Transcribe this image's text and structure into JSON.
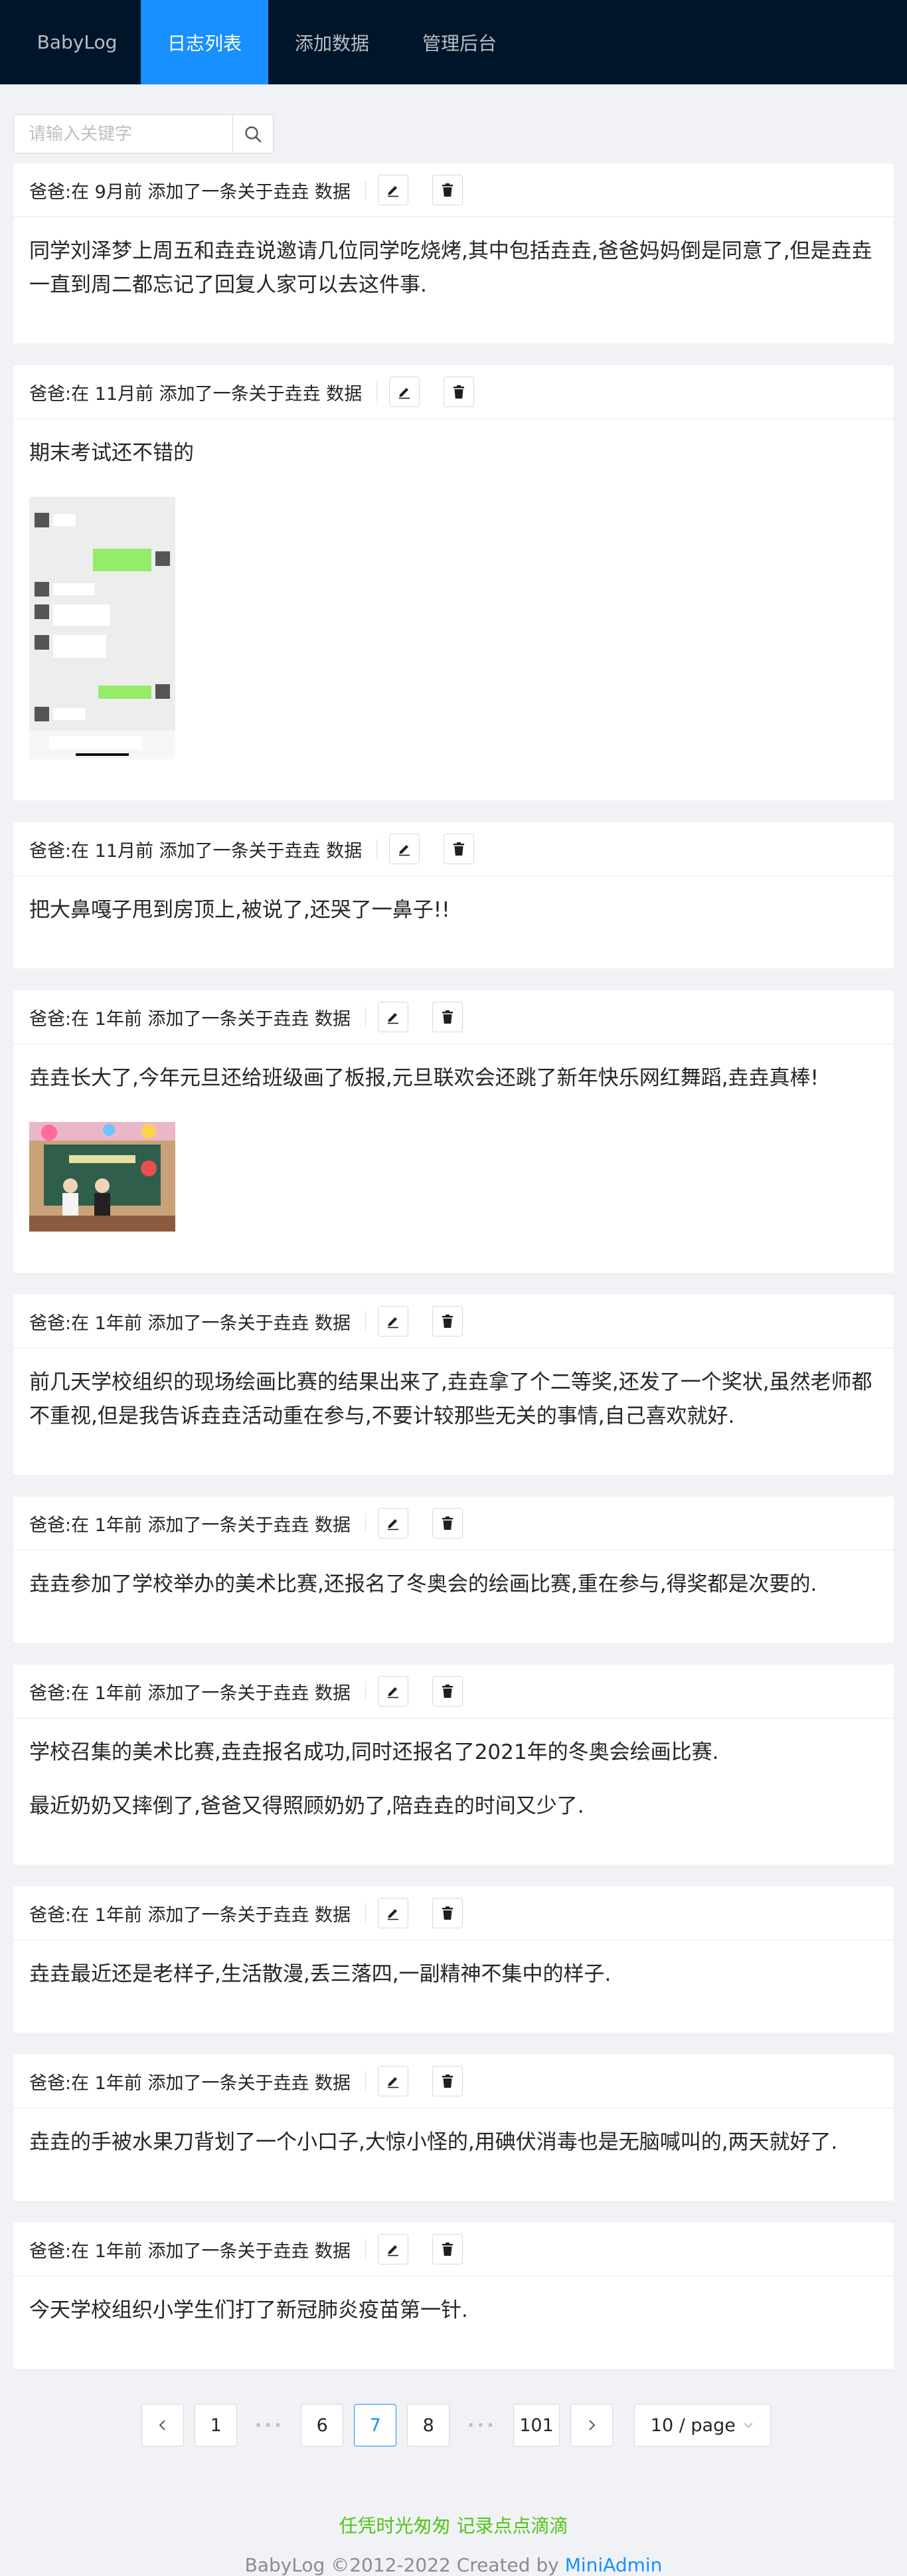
{
  "nav": {
    "items": [
      {
        "label": "BabyLog"
      },
      {
        "label": "日志列表"
      },
      {
        "label": "添加数据"
      },
      {
        "label": "管理后台"
      }
    ]
  },
  "search": {
    "placeholder": "请输入关键字",
    "value": ""
  },
  "logs": [
    {
      "header": "爸爸:在 9月前 添加了一条关于垚垚 数据",
      "paragraphs": [
        "同学刘泽梦上周五和垚垚说邀请几位同学吃烧烤,其中包括垚垚,爸爸妈妈倒是同意了,但是垚垚一直到周二都忘记了回复人家可以去这件事."
      ]
    },
    {
      "header": "爸爸:在 11月前 添加了一条关于垚垚 数据",
      "paragraphs": [
        "期末考试还不错的"
      ],
      "image": "chat-screenshot"
    },
    {
      "header": "爸爸:在 11月前 添加了一条关于垚垚 数据",
      "paragraphs": [
        "把大鼻嘎子甩到房顶上,被说了,还哭了一鼻子!!"
      ]
    },
    {
      "header": "爸爸:在 1年前 添加了一条关于垚垚 数据",
      "paragraphs": [
        "垚垚长大了,今年元旦还给班级画了板报,元旦联欢会还跳了新年快乐网红舞蹈,垚垚真棒!"
      ],
      "image": "classroom-photo"
    },
    {
      "header": "爸爸:在 1年前 添加了一条关于垚垚 数据",
      "paragraphs": [
        "前几天学校组织的现场绘画比赛的结果出来了,垚垚拿了个二等奖,还发了一个奖状,虽然老师都不重视,但是我告诉垚垚活动重在参与,不要计较那些无关的事情,自己喜欢就好."
      ]
    },
    {
      "header": "爸爸:在 1年前 添加了一条关于垚垚 数据",
      "paragraphs": [
        "垚垚参加了学校举办的美术比赛,还报名了冬奥会的绘画比赛,重在参与,得奖都是次要的."
      ]
    },
    {
      "header": "爸爸:在 1年前 添加了一条关于垚垚 数据",
      "paragraphs": [
        "学校召集的美术比赛,垚垚报名成功,同时还报名了2021年的冬奥会绘画比赛.",
        "最近奶奶又摔倒了,爸爸又得照顾奶奶了,陪垚垚的时间又少了."
      ]
    },
    {
      "header": "爸爸:在 1年前 添加了一条关于垚垚 数据",
      "paragraphs": [
        "垚垚最近还是老样子,生活散漫,丢三落四,一副精神不集中的样子."
      ]
    },
    {
      "header": "爸爸:在 1年前 添加了一条关于垚垚 数据",
      "paragraphs": [
        "垚垚的手被水果刀背划了一个小口子,大惊小怪的,用碘伏消毒也是无脑喊叫的,两天就好了."
      ]
    },
    {
      "header": "爸爸:在 1年前 添加了一条关于垚垚 数据",
      "paragraphs": [
        "今天学校组织小学生们打了新冠肺炎疫苗第一针."
      ]
    }
  ],
  "pagination": {
    "pages": [
      "1",
      "6",
      "7",
      "8",
      "101"
    ],
    "current": "7",
    "ellipsis": "•••",
    "page_size": "10 / page"
  },
  "footer": {
    "slogan": "任凭时光匆匆 记录点点滴滴",
    "copyright": "BabyLog ©2012-2022 Created by",
    "link": "MiniAdmin"
  },
  "colors": {
    "nav_bg": "#001529",
    "accent": "#1890ff",
    "slogan": "#52c41a"
  },
  "icons": {
    "search": "search-icon",
    "edit": "edit-icon",
    "delete": "delete-icon",
    "prev": "chevron-left-icon",
    "next": "chevron-right-icon",
    "dropdown": "chevron-down-icon"
  }
}
